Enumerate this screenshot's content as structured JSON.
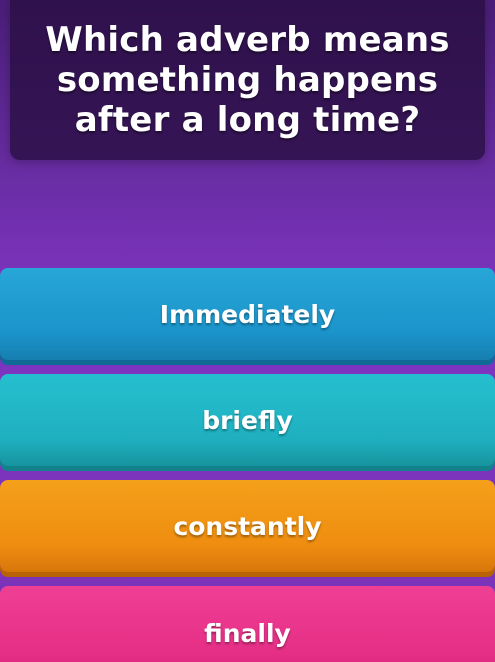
{
  "question": {
    "text": "Which adverb means something happens after a long time?"
  },
  "answers": [
    {
      "label": "Immediately",
      "color": "#1f9dd1"
    },
    {
      "label": "briefly",
      "color": "#20b4c4"
    },
    {
      "label": "constantly",
      "color": "#f19512"
    },
    {
      "label": "finally",
      "color": "#e93689"
    }
  ],
  "theme": {
    "background": "#6f2fac",
    "question_card": "#2a0f44"
  }
}
